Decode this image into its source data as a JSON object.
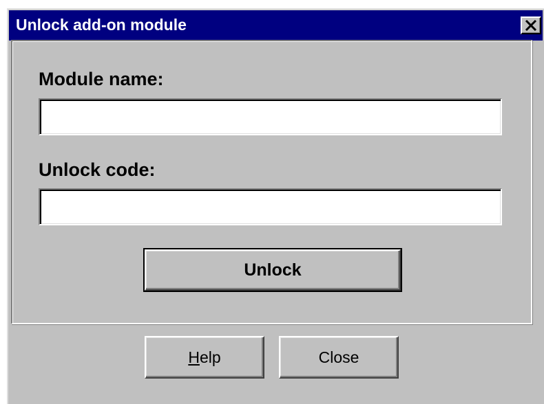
{
  "window": {
    "title": "Unlock add-on module"
  },
  "form": {
    "module_name_label": "Module name:",
    "module_name_value": "",
    "unlock_code_label": "Unlock code:",
    "unlock_code_value": ""
  },
  "buttons": {
    "unlock_label": "Unlock",
    "help_mnemonic": "H",
    "help_rest": "elp",
    "close_label": "Close"
  },
  "icons": {
    "close": "close-icon"
  },
  "colors": {
    "titlebar": "#000080",
    "face": "#c0c0c0",
    "title_text": "#ffffff"
  }
}
